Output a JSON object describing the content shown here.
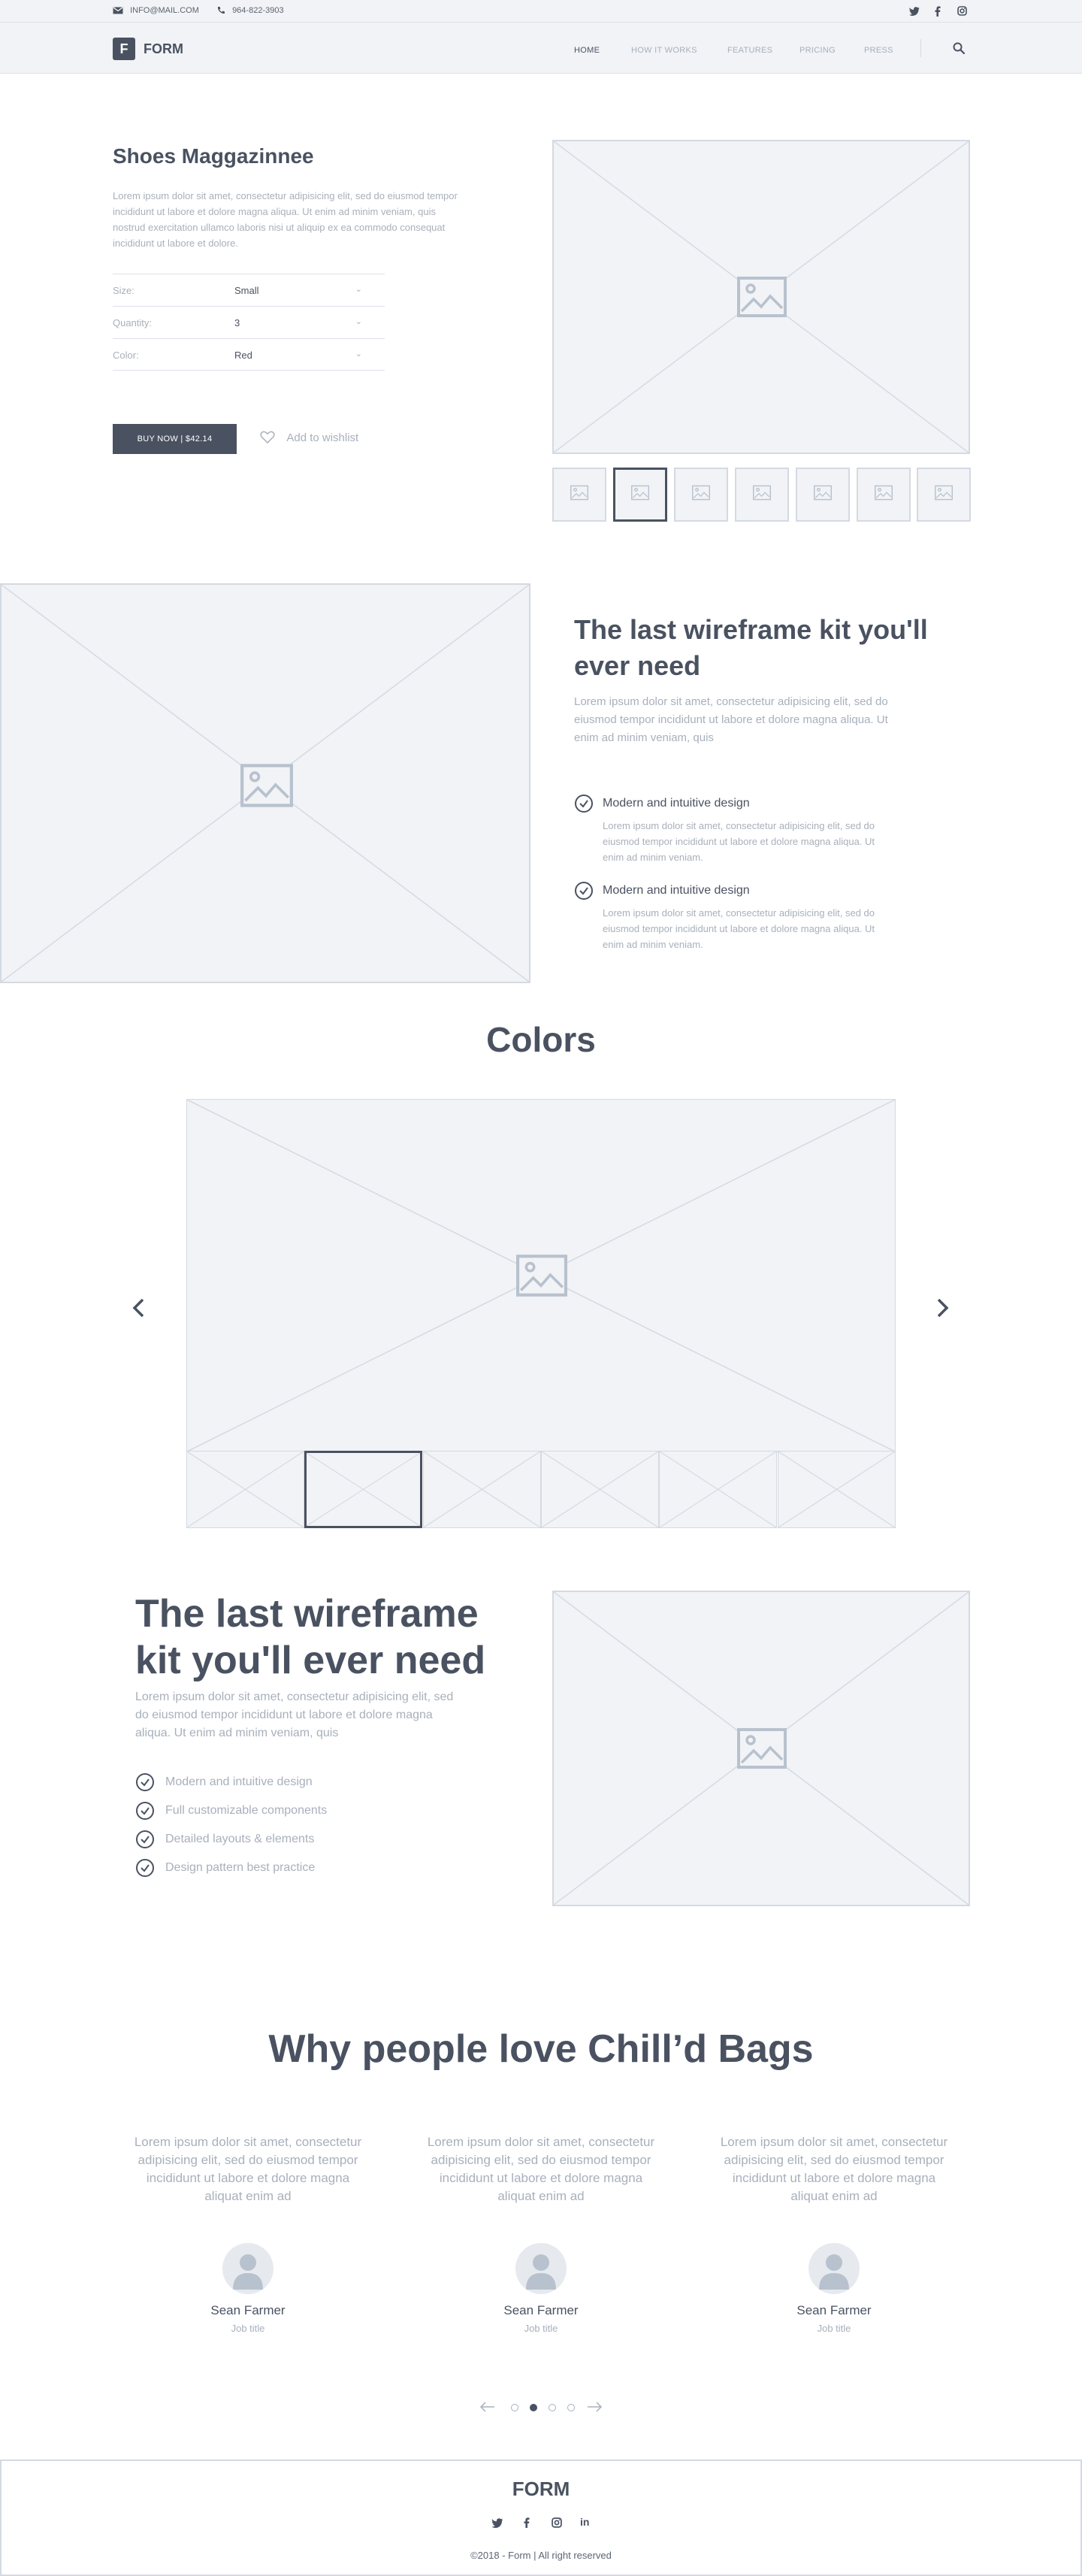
{
  "topbar": {
    "email": "INFO@MAIL.COM",
    "phone": "964-822-3903",
    "social_icons": [
      "twitter-icon",
      "facebook-icon",
      "instagram-icon"
    ]
  },
  "nav": {
    "logo_letter": "F",
    "logo_text": "FORM",
    "links": [
      "HOME",
      "HOW IT WORKS",
      "FEATURES",
      "PRICING",
      "PRESS"
    ],
    "active": "HOME"
  },
  "product": {
    "title": "Shoes Maggazinnee",
    "description": "Lorem ipsum dolor sit amet, consectetur adipisicing elit, sed do eiusmod tempor incididunt ut labore et dolore magna aliqua. Ut enim ad minim veniam, quis nostrud exercitation ullamco laboris nisi ut aliquip ex ea commodo consequat incididunt ut labore et dolore.",
    "options": [
      {
        "label": "Size:",
        "value": "Small"
      },
      {
        "label": "Quantity:",
        "value": "3"
      },
      {
        "label": "Color:",
        "value": "Red"
      }
    ],
    "buy_label": "BUY NOW  |  $42.14",
    "wishlist_label": "Add to wishlist",
    "selected_thumb": 1
  },
  "feature1": {
    "title": "The last wireframe kit you'll ever need",
    "description": "Lorem ipsum dolor sit amet, consectetur adipisicing elit, sed do eiusmod tempor incididunt ut labore et dolore magna aliqua. Ut enim ad minim veniam, quis",
    "items": [
      {
        "title": "Modern and intuitive design",
        "desc": "Lorem ipsum dolor sit amet, consectetur adipisicing elit, sed do eiusmod tempor incididunt ut labore et dolore magna aliqua. Ut enim ad minim veniam."
      },
      {
        "title": "Modern and intuitive design",
        "desc": "Lorem ipsum dolor sit amet, consectetur adipisicing elit, sed do eiusmod tempor incididunt ut labore et dolore magna aliqua. Ut enim ad minim veniam."
      }
    ]
  },
  "colors": {
    "title": "Colors",
    "selected_thumb": 1
  },
  "feature2": {
    "title": "The last wireframe kit you'll ever need",
    "description": "Lorem ipsum dolor sit amet, consectetur adipisicing elit, sed do eiusmod tempor incididunt ut labore et dolore magna aliqua. Ut enim ad minim veniam, quis",
    "items": [
      "Modern and intuitive design",
      "Full customizable components",
      "Detailed layouts & elements",
      "Design pattern best practice"
    ]
  },
  "testimonials": {
    "title": "Why people love Chill’d Bags",
    "items": [
      {
        "quote": "Lorem ipsum dolor sit amet, consectetur adipisicing elit, sed do eiusmod tempor incididunt ut labore et dolore magna aliquat enim ad",
        "name": "Sean Farmer",
        "job": "Job title"
      },
      {
        "quote": "Lorem ipsum dolor sit amet, consectetur adipisicing elit, sed do eiusmod tempor incididunt ut labore et dolore magna aliquat enim ad",
        "name": "Sean Farmer",
        "job": "Job title"
      },
      {
        "quote": "Lorem ipsum dolor sit amet, consectetur adipisicing elit, sed do eiusmod tempor incididunt ut labore et dolore magna aliquat enim ad",
        "name": "Sean Farmer",
        "job": "Job title"
      }
    ],
    "pager_active": 1
  },
  "footer": {
    "logo_text": "FORM",
    "social_icons": [
      "twitter-icon",
      "facebook-icon",
      "instagram-icon",
      "linkedin-icon"
    ],
    "copyright": "©2018 - Form  |   All right reserved"
  },
  "colors_palette": {
    "primary": "#4a5261",
    "muted": "#a8b0bb",
    "placeholder_bg": "#f1f3f6",
    "border": "#d4dae2"
  }
}
